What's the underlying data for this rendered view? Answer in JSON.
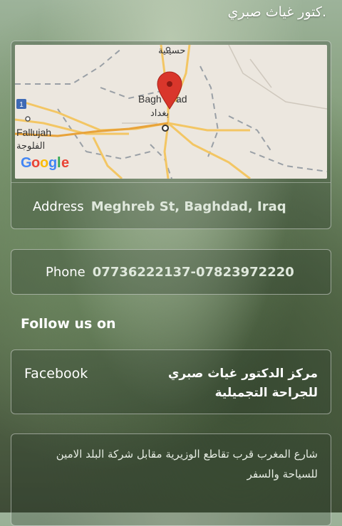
{
  "header": {
    "title": ".كتور غياث صبري"
  },
  "map": {
    "city_label": "Baghdad",
    "city_label_visible": "Bagh",
    "city_label_visible_end": "ad",
    "city_label_ar": "بغداد",
    "fallujah_label": "Fallujah",
    "fallujah_label_ar": "الفلوجة",
    "top_label_ar": "حسينية",
    "route_shield": "1",
    "logo": [
      "G",
      "o",
      "o",
      "g",
      "l",
      "e"
    ],
    "logo_colors": [
      "#4285F4",
      "#EA4335",
      "#FBBC05",
      "#4285F4",
      "#34A853",
      "#EA4335"
    ],
    "pin_color": "#d9362b"
  },
  "address": {
    "label": "Address",
    "value": "Meghreb St, Baghdad, Iraq"
  },
  "phone": {
    "label": "Phone",
    "value": "07736222137-07823972220"
  },
  "follow": {
    "title": "Follow us on"
  },
  "facebook": {
    "label": "Facebook",
    "name": "مركز الدكتور غياث صبري للجراحة التجميلية"
  },
  "description": {
    "text": "شارع المغرب قرب تقاطع الوزيرية مقابل شركة البلد الامين للسياحة والسفر"
  }
}
